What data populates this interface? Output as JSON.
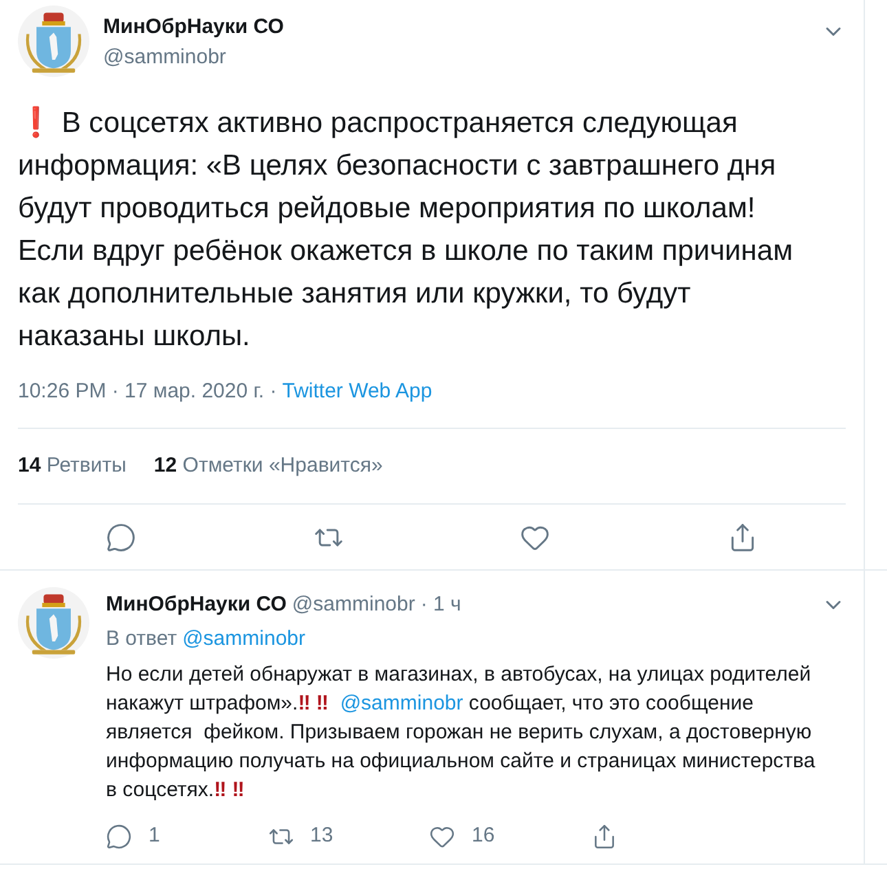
{
  "tweet": {
    "author": "МинОбрНауки СО",
    "handle": "@samminobr",
    "body": [
      {
        "kind": "emoji",
        "text": "❗"
      },
      {
        "kind": "text",
        "text": " В соцсетях активно распространяется следующая информация: «В целях безопасности с завтрашнего дня будут проводиться рейдовые мероприятия по школам! Если вдруг ребёнок окажется в школе по таким причинам как дополнительные занятия или кружки, то будут наказаны школы."
      }
    ],
    "time": "10:26 PM · 17 мар. 2020 г. ·",
    "source": "Twitter Web App",
    "stats": [
      {
        "count": "14",
        "label": "Ретвиты"
      },
      {
        "count": "12",
        "label": "Отметки «Нравится»"
      }
    ],
    "actions": [
      {
        "kind": "reply"
      },
      {
        "kind": "retweet"
      },
      {
        "kind": "like"
      },
      {
        "kind": "share"
      }
    ]
  },
  "reply": {
    "author": "МинОбрНауки СО",
    "handle": "@samminobr",
    "age": "· 1 ч",
    "in_reply_prefix": "В ответ",
    "in_reply_to": "@samminobr",
    "body": [
      {
        "kind": "text",
        "text": "Но если детей обнаружат в магазинах, в автобусах, на улицах родителей накажут штрафом»."
      },
      {
        "kind": "emoji",
        "text": "‼ ‼  "
      },
      {
        "kind": "mention",
        "text": "@samminobr"
      },
      {
        "kind": "text",
        "text": " сообщает, что это сообщение является  фейком. Призываем горожан не верить слухам, а достоверную информацию получать на официальном сайте и страницах министерства в соцсетях."
      },
      {
        "kind": "emoji",
        "text": "‼ ‼"
      }
    ],
    "actions": [
      {
        "kind": "reply",
        "count": "1"
      },
      {
        "kind": "retweet",
        "count": "13"
      },
      {
        "kind": "like",
        "count": "16"
      },
      {
        "kind": "share"
      }
    ]
  }
}
